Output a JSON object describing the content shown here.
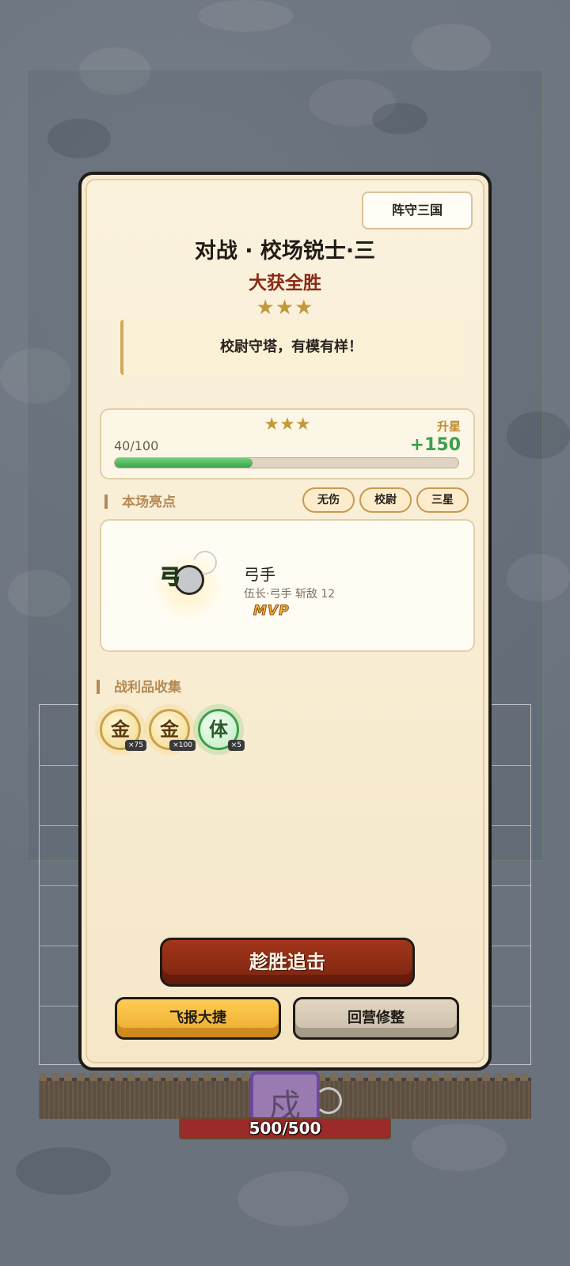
{
  "header": {
    "mode_tag": "阵守三国",
    "title": "对战 · 校场锐士·三",
    "result": "大获全胜",
    "stars": "★★★",
    "quote": "校尉守塔，有模有样！"
  },
  "star_progress": {
    "stars": "★★★",
    "label": "升星",
    "count": "40/100",
    "gain": "+150",
    "fill_fraction": 0.4
  },
  "highlights": {
    "heading": "本场亮点",
    "tags": [
      "无伤",
      "校尉",
      "三星"
    ]
  },
  "mvp": {
    "icon_glyph": "弓",
    "name": "弓手",
    "detail": "伍长·弓手 斩敌 12",
    "badge": "MVP"
  },
  "loot": {
    "heading": "战利品收集",
    "items": [
      {
        "glyph": "金",
        "qty": "×75",
        "color": "#c9a247"
      },
      {
        "glyph": "金",
        "qty": "×100",
        "color": "#c9a247"
      },
      {
        "glyph": "体",
        "qty": "×5",
        "color": "#3aa04a"
      }
    ]
  },
  "buttons": {
    "primary": "趁胜追击",
    "report": "飞报大捷",
    "camp": "回营修整"
  },
  "battlefield": {
    "fort_glyph": "戍",
    "hp_text": "500/500"
  },
  "colors": {
    "primary_button": "#8c2a14",
    "accent_gold": "#c29a3c",
    "progress_green": "#3da54d",
    "panel_bg": "#f7ead0"
  }
}
